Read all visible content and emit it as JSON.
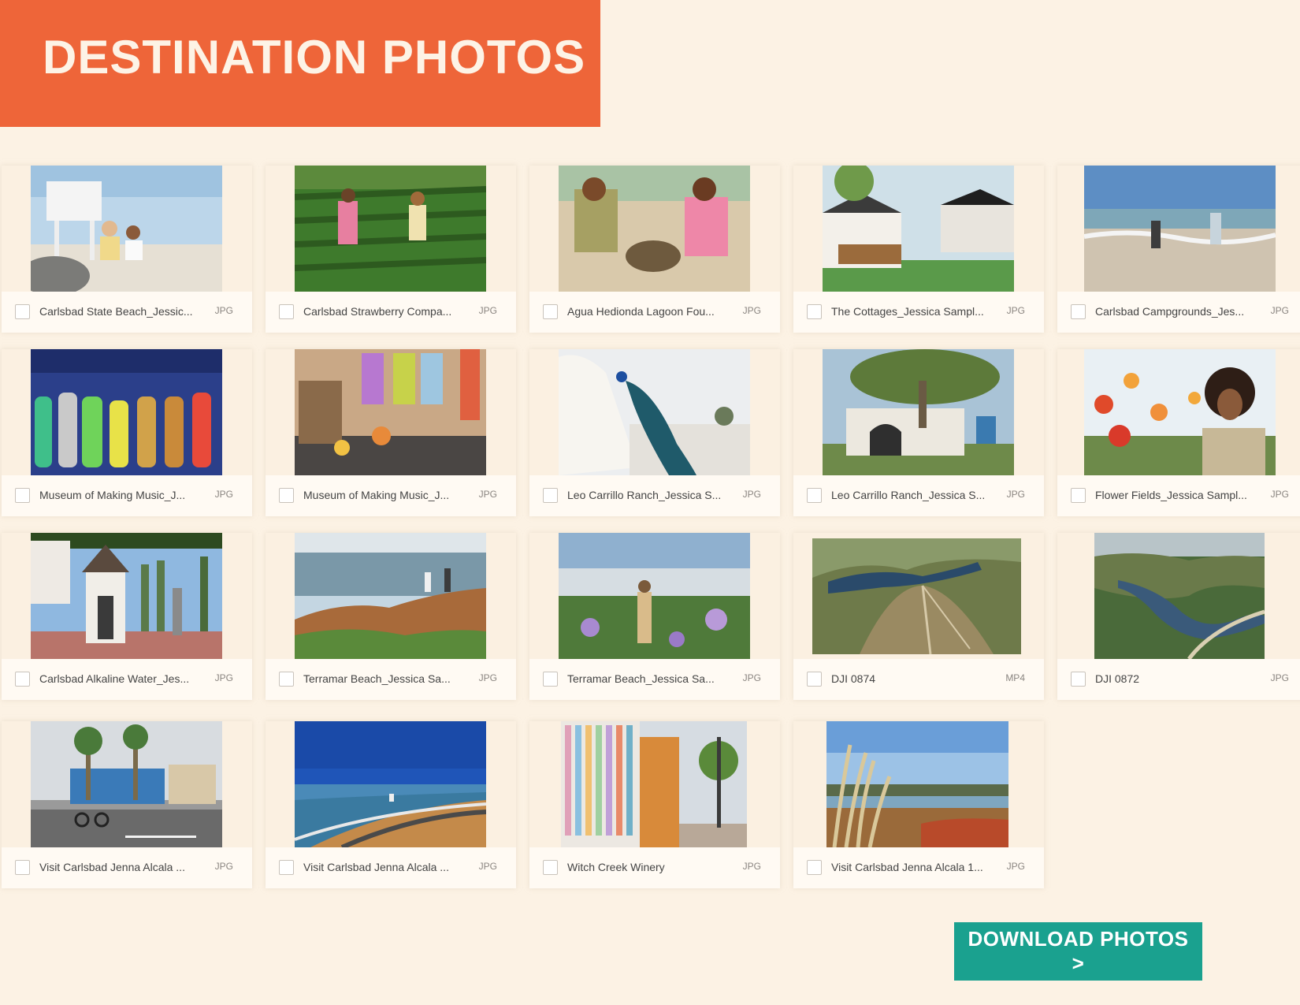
{
  "header": {
    "title": "DESTINATION PHOTOS"
  },
  "photos": [
    {
      "name": "Carlsbad State Beach_Jessic...",
      "type": "JPG",
      "thumb": "lifeguard-tower-beach-photo"
    },
    {
      "name": "Carlsbad Strawberry Compa...",
      "type": "JPG",
      "thumb": "strawberry-field-photo"
    },
    {
      "name": "Agua Hedionda Lagoon Fou...",
      "type": "JPG",
      "thumb": "girls-with-tortoise-photo"
    },
    {
      "name": "The Cottages_Jessica Sampl...",
      "type": "JPG",
      "thumb": "cottages-patio-photo"
    },
    {
      "name": "Carlsbad Campgrounds_Jes...",
      "type": "JPG",
      "thumb": "kids-on-shore-photo"
    },
    {
      "name": "Museum of Making Music_J...",
      "type": "JPG",
      "thumb": "guitar-wall-photo"
    },
    {
      "name": "Museum of Making Music_J...",
      "type": "JPG",
      "thumb": "museum-kids-room-photo"
    },
    {
      "name": "Leo Carrillo Ranch_Jessica S...",
      "type": "JPG",
      "thumb": "peacock-on-wall-photo"
    },
    {
      "name": "Leo Carrillo Ranch_Jessica S...",
      "type": "JPG",
      "thumb": "ranch-tree-photo"
    },
    {
      "name": "Flower Fields_Jessica Sampl...",
      "type": "JPG",
      "thumb": "woman-with-flowers-photo"
    },
    {
      "name": "Carlsbad Alkaline Water_Jes...",
      "type": "JPG",
      "thumb": "water-kiosk-photo"
    },
    {
      "name": "Terramar Beach_Jessica Sa...",
      "type": "JPG",
      "thumb": "bluff-ocean-photo"
    },
    {
      "name": "Terramar Beach_Jessica Sa...",
      "type": "JPG",
      "thumb": "bluff-flowers-photo"
    },
    {
      "name": "DJI 0874",
      "type": "MP4",
      "thumb": "aerial-lagoon-video"
    },
    {
      "name": "DJI 0872",
      "type": "JPG",
      "thumb": "aerial-lake-photo"
    },
    {
      "name": "Visit Carlsbad Jenna Alcala ...",
      "type": "JPG",
      "thumb": "village-street-photo"
    },
    {
      "name": "Visit Carlsbad Jenna Alcala ...",
      "type": "JPG",
      "thumb": "coastal-highway-photo"
    },
    {
      "name": "Witch Creek Winery",
      "type": "JPG",
      "thumb": "winery-mural-photo"
    },
    {
      "name": "Visit Carlsbad Jenna Alcala 1...",
      "type": "JPG",
      "thumb": "pampas-grass-lagoon-photo"
    }
  ],
  "download_button": {
    "label": "DOWNLOAD PHOTOS >"
  }
}
